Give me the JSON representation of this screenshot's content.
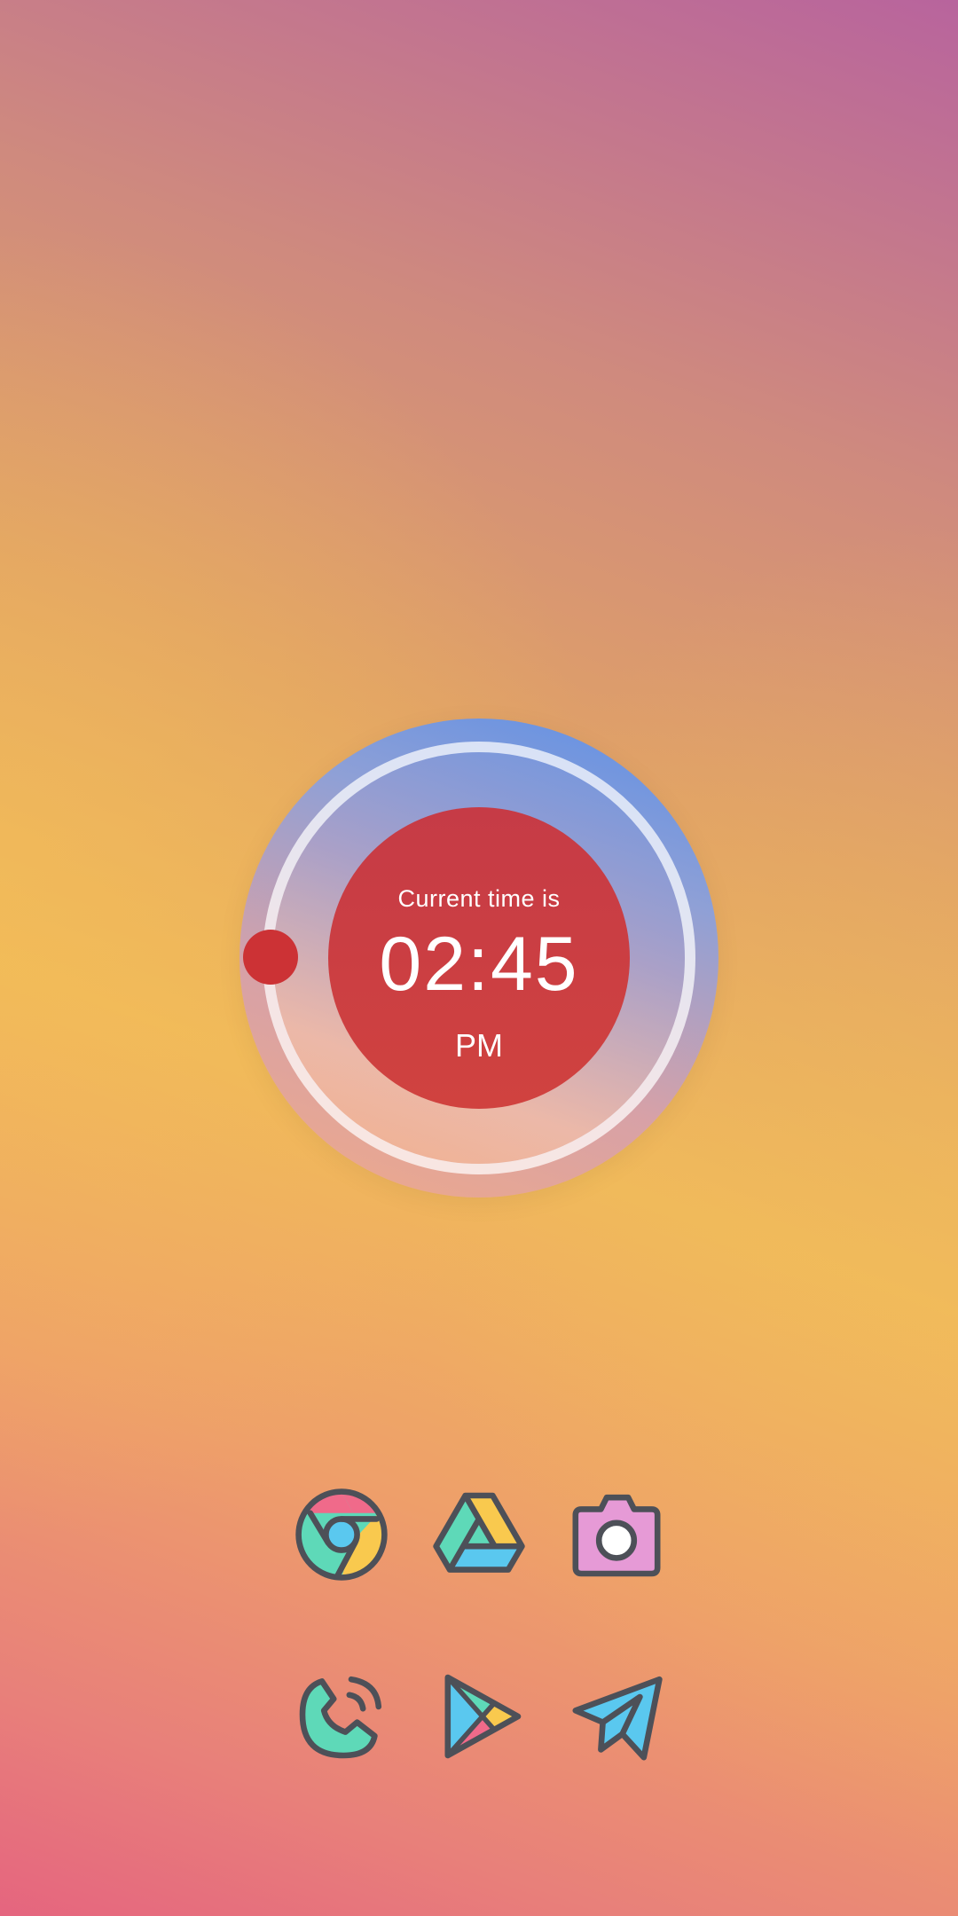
{
  "clock_widget": {
    "label": "Current time is",
    "time": "02:45",
    "ampm": "PM"
  },
  "dock": {
    "row1": [
      {
        "icon": "chrome-icon"
      },
      {
        "icon": "drive-icon"
      },
      {
        "icon": "camera-icon"
      }
    ],
    "row2": [
      {
        "icon": "phone-icon"
      },
      {
        "icon": "play-store-icon"
      },
      {
        "icon": "send-icon"
      }
    ]
  },
  "colors": {
    "clock_face": "#cc3d43",
    "icon_stroke": "#4d5058",
    "teal": "#5ed9b8",
    "yellow": "#f9c94e",
    "blue": "#5ac8ef",
    "pink": "#f06a8a",
    "lilac": "#e69ad6"
  }
}
